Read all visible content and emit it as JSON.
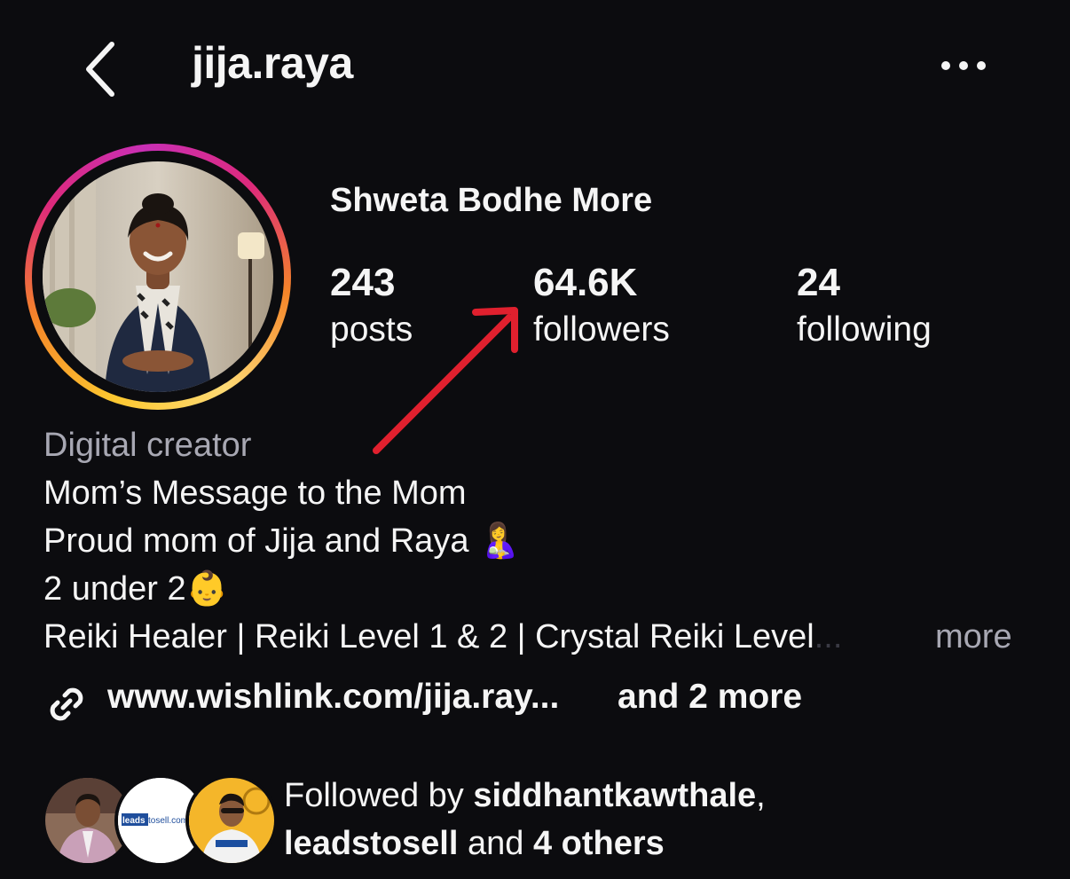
{
  "header": {
    "username": "jija.raya",
    "back_icon": "chevron-left-icon",
    "menu_icon": "more-horizontal-icon"
  },
  "profile": {
    "display_name": "Shweta Bodhe More",
    "avatar_ring_colors": [
      "#feda75",
      "#fa7e1e",
      "#d62976",
      "#962fbf"
    ]
  },
  "stats": [
    {
      "count": "243",
      "label": "posts"
    },
    {
      "count": "64.6K",
      "label": "followers"
    },
    {
      "count": "24",
      "label": "following"
    }
  ],
  "annotation": {
    "arrow_color": "#e0202e",
    "points_to": "followers"
  },
  "bio": {
    "category": "Digital creator",
    "lines": [
      "Mom’s Message to the Mom",
      "Proud mom of Jija and Raya 🤱",
      "2 under 2👶",
      "Reiki Healer | Reiki Level 1 & 2 | Crystal Reiki Level"
    ],
    "truncation": "...",
    "more_label": "more"
  },
  "links": {
    "icon": "link-icon",
    "url_text": "www.wishlink.com/jija.ray...",
    "more_text": "and 2 more"
  },
  "followed_by": {
    "prefix": "Followed by ",
    "user1": "siddhantkawthale",
    "sep": ",",
    "user2": "leadstosell",
    "mid": " and ",
    "others": "4 others",
    "avatar2_text": "leadstosell.com"
  }
}
